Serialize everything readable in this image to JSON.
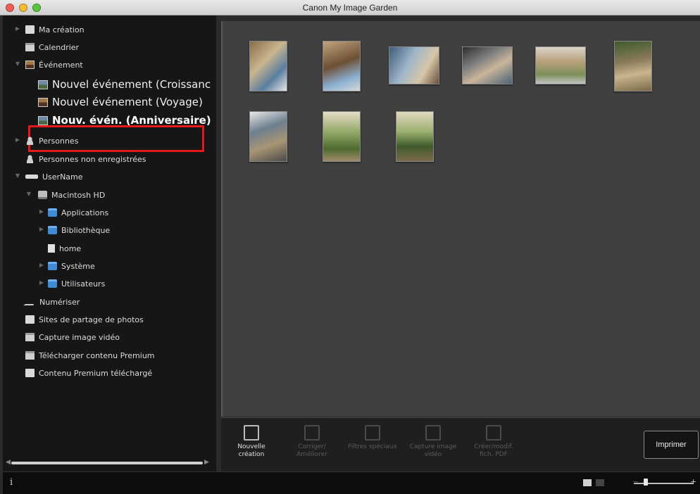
{
  "window": {
    "title": "Canon My Image Garden"
  },
  "sidebar": {
    "items": [
      {
        "label": "Ma création"
      },
      {
        "label": "Calendrier"
      },
      {
        "label": "Événement"
      },
      {
        "label": "Nouvel événement (Croissanc"
      },
      {
        "label": "Nouvel événement (Voyage)"
      },
      {
        "label": "Nouv. évén. (Anniversaire)"
      },
      {
        "label": "Personnes"
      },
      {
        "label": "Personnes non enregistrées"
      },
      {
        "label": "UserName"
      },
      {
        "label": "Macintosh HD"
      },
      {
        "label": "Applications"
      },
      {
        "label": "Bibliothèque"
      },
      {
        "label": "home"
      },
      {
        "label": "Système"
      },
      {
        "label": "Utilisateurs"
      },
      {
        "label": "Numériser"
      },
      {
        "label": "Sites de partage de photos"
      },
      {
        "label": "Capture image vidéo"
      },
      {
        "label": "Télécharger contenu Premium"
      },
      {
        "label": "Contenu Premium téléchargé"
      }
    ]
  },
  "toolbar": {
    "tools": [
      {
        "label": "Nouvelle création",
        "enabled": true
      },
      {
        "label": "Corriger/ Améliorer",
        "enabled": false
      },
      {
        "label": "Filtres spéciaux",
        "enabled": false
      },
      {
        "label": "Capture image vidéo",
        "enabled": false
      },
      {
        "label": "Créer/modif. fich. PDF",
        "enabled": false
      }
    ],
    "print_label": "Imprimer"
  },
  "footer": {
    "info_glyph": "i",
    "zoom_plus": "+",
    "zoom_minus": "−"
  },
  "colors": {
    "highlight": "#e51919",
    "sidebar_bg": "#161616",
    "main_bg": "#404040"
  }
}
